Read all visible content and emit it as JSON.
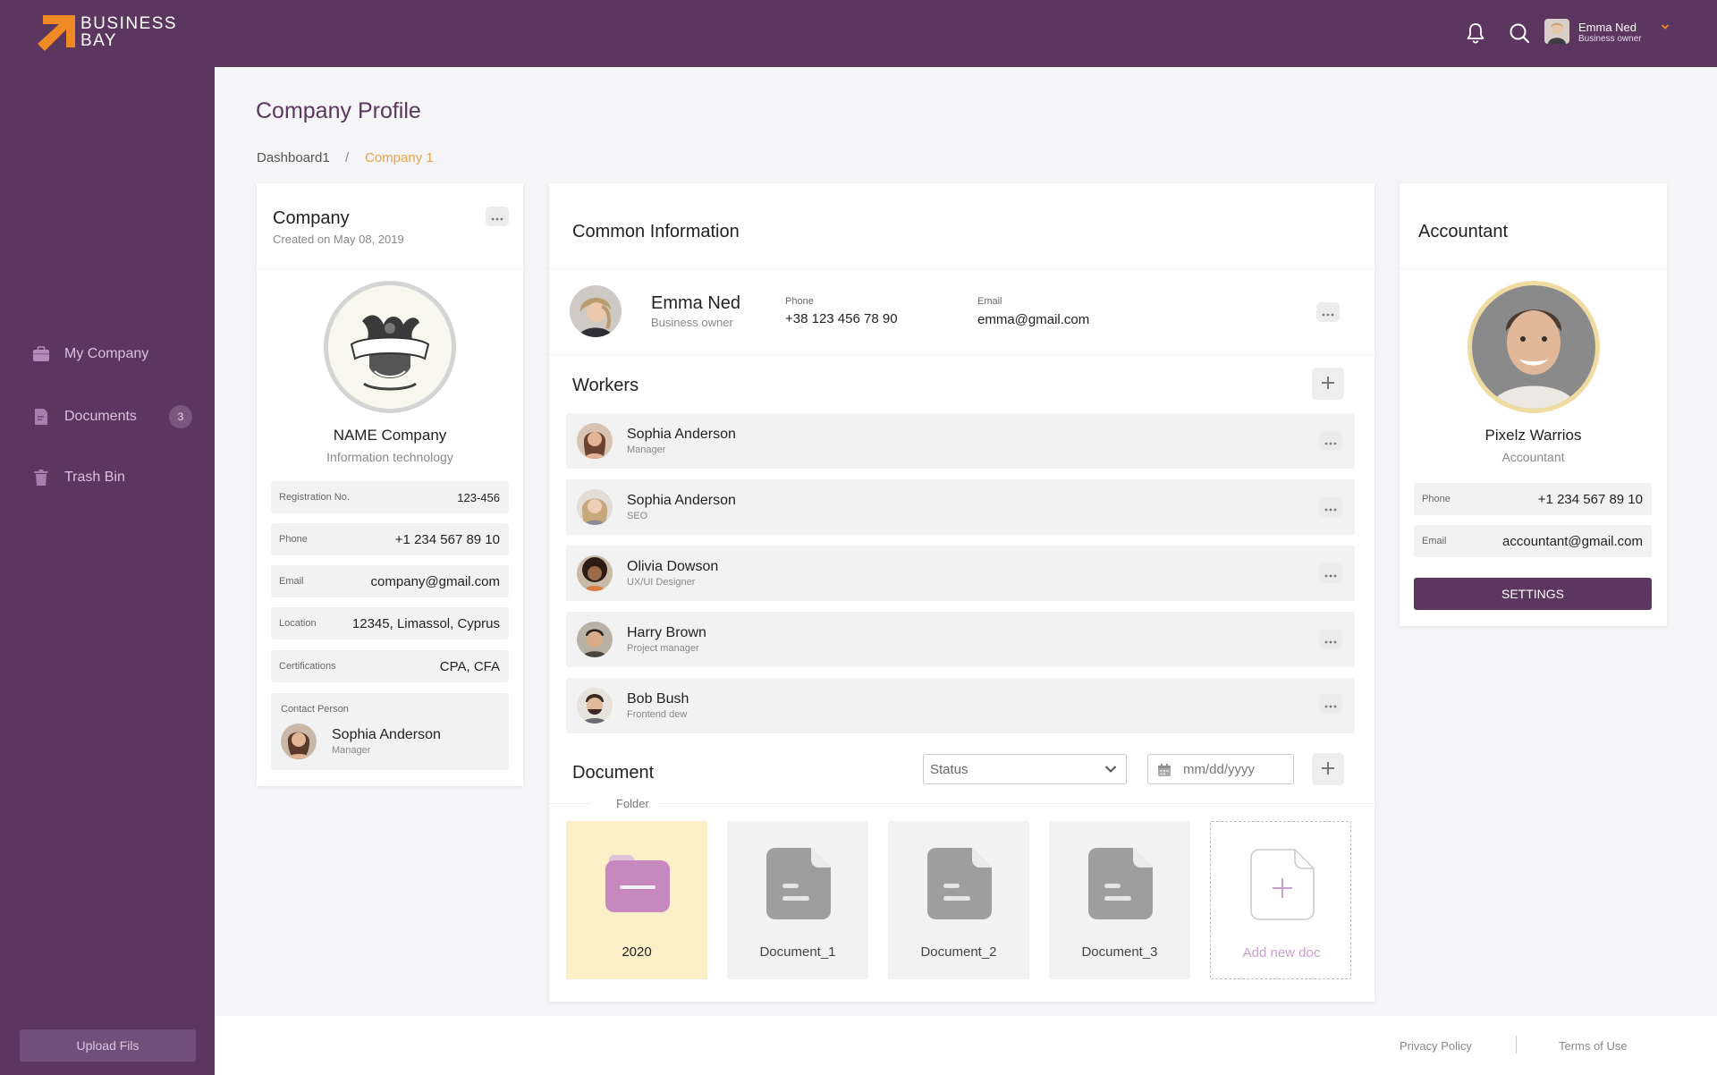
{
  "brand": {
    "line1": "Business",
    "line2": "Bay",
    "accent": "#f08a24",
    "primary": "#5b365e"
  },
  "header": {
    "user_name": "Emma Ned",
    "user_role": "Business owner"
  },
  "sidebar": {
    "items": [
      {
        "label": "My Company",
        "icon": "briefcase-icon"
      },
      {
        "label": "Documents",
        "icon": "document-icon",
        "badge": "3"
      },
      {
        "label": "Trash Bin",
        "icon": "trash-icon"
      }
    ],
    "upload_label": "Upload Fils"
  },
  "page": {
    "title": "Company Profile",
    "crumb1": "Dashboard1",
    "crumb_sep": "/",
    "crumb2": "Company 1"
  },
  "company": {
    "title": "Company",
    "created": "Created on May 08, 2019",
    "name": "NAME Company",
    "industry": "Information technology",
    "rows": [
      {
        "label": "Registration No.",
        "value": "123-456"
      },
      {
        "label": "Phone",
        "value": "+1 234 567 89 10"
      },
      {
        "label": "Email",
        "value": "company@gmail.com"
      },
      {
        "label": "Location",
        "value": "12345, Limassol, Cyprus"
      },
      {
        "label": "Certifications",
        "value": "CPA, CFA"
      }
    ],
    "contact": {
      "label": "Contact Person",
      "name": "Sophia Anderson",
      "role": "Manager"
    }
  },
  "common": {
    "title": "Common Information",
    "person": {
      "name": "Emma Ned",
      "role": "Business owner",
      "phone_label": "Phone",
      "phone": "+38 123 456 78 90",
      "email_label": "Email",
      "email": "emma@gmail.com"
    },
    "workers_title": "Workers",
    "workers": [
      {
        "name": "Sophia Anderson",
        "role": "Manager"
      },
      {
        "name": "Sophia Anderson",
        "role": "SEO"
      },
      {
        "name": "Olivia Dowson",
        "role": "UX/UI Designer"
      },
      {
        "name": "Harry Brown",
        "role": "Project manager"
      },
      {
        "name": "Bob Bush",
        "role": "Frontend dew"
      }
    ],
    "document_title": "Document",
    "status_value": "Status",
    "date_placeholder": "mm/dd/yyyy",
    "folder_label": "Folder",
    "tiles": [
      "2020",
      "Document_1",
      "Document_2",
      "Document_3",
      "Add new doc"
    ]
  },
  "accountant": {
    "title": "Accountant",
    "name": "Pixelz Warrios",
    "role": "Accountant",
    "rows": [
      {
        "label": "Phone",
        "value": "+1 234 567 89 10"
      },
      {
        "label": "Email",
        "value": "accountant@gmail.com"
      }
    ],
    "button": "SETTINGS"
  },
  "footer": {
    "privacy": "Privacy Policy",
    "terms": "Terms of Use"
  }
}
